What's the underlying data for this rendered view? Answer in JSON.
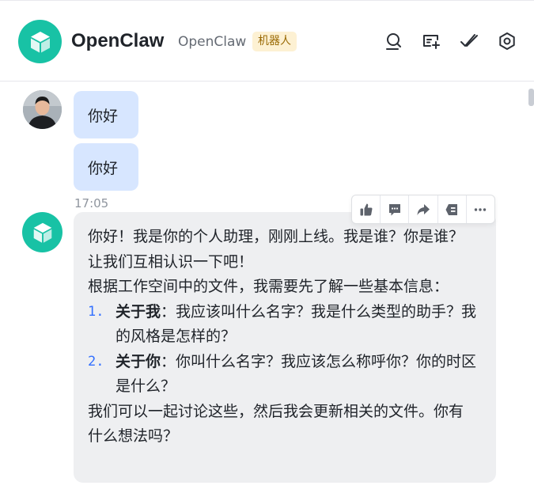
{
  "header": {
    "title": "OpenClaw",
    "subtitle": "OpenClaw",
    "badge": "机器人",
    "icons": [
      "search-icon",
      "new-topic-icon",
      "mark-done-icon",
      "settings-icon"
    ]
  },
  "messages": {
    "user": [
      "你好",
      "你好"
    ],
    "timestamp": "17:05",
    "bot": {
      "line1": "你好！我是你的个人助理，刚刚上线。我是谁？你是谁？让我们互相认识一下吧！",
      "line2": "根据工作空间中的文件，我需要先了解一些基本信息：",
      "items": [
        {
          "num": "1.",
          "bold": "关于我",
          "text": "：我应该叫什么名字？我是什么类型的助手？我的风格是怎样的？"
        },
        {
          "num": "2.",
          "bold": "关于你",
          "text": "：你叫什么名字？我应该怎么称呼你？你的时区是什么？"
        }
      ],
      "line3": "我们可以一起讨论这些，然后我会更新相关的文件。你有什么想法吗？"
    }
  },
  "toolbar": {
    "icons": [
      "thumbs-up-icon",
      "comment-icon",
      "forward-icon",
      "pin-icon",
      "more-icon"
    ]
  },
  "colors": {
    "accent": "#18c2a5",
    "user_bubble": "#d7e6ff",
    "bot_bubble": "#eeeff1",
    "badge_bg": "#fdf1d3",
    "list_number": "#3370ff"
  }
}
